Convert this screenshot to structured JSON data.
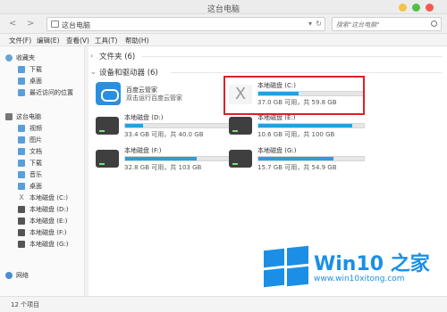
{
  "window": {
    "title": "这台电脑"
  },
  "address": {
    "path": "这台电脑",
    "search_placeholder": "搜索\"这台电脑\""
  },
  "menu": [
    "文件(F)",
    "编辑(E)",
    "查看(V)",
    "工具(T)",
    "帮助(H)"
  ],
  "sidebar": {
    "favorites": {
      "label": "收藏夹",
      "items": [
        "下载",
        "桌面",
        "最近访问的位置"
      ]
    },
    "computer": {
      "label": "这台电脑",
      "items": [
        "视频",
        "图片",
        "文档",
        "下载",
        "音乐",
        "桌面",
        "本地磁盘 (C:)",
        "本地磁盘 (D:)",
        "本地磁盘 (E:)",
        "本地磁盘 (F:)",
        "本地磁盘 (G:)"
      ]
    },
    "network": {
      "label": "网络"
    }
  },
  "groups": {
    "folders": "文件夹 (6)",
    "devices": "设备和驱动器 (6)"
  },
  "cloud": {
    "name": "百度云管家",
    "sub": "双击运行百度云管家"
  },
  "drives": [
    {
      "name": "本地磁盘 (C:)",
      "size": "37.0 GB 可用，共 59.8 GB",
      "used_fraction": 0.38
    },
    {
      "name": "本地磁盘 (D:)",
      "size": "33.4 GB 可用，共 40.0 GB",
      "used_fraction": 0.17
    },
    {
      "name": "本地磁盘 (E:)",
      "size": "10.6 GB 可用，共 100 GB",
      "used_fraction": 0.89
    },
    {
      "name": "本地磁盘 (F:)",
      "size": "32.8 GB 可用，共 103 GB",
      "used_fraction": 0.68
    },
    {
      "name": "本地磁盘 (G:)",
      "size": "15.7 GB 可用，共 54.9 GB",
      "used_fraction": 0.71
    }
  ],
  "status": {
    "text": "12 个项目"
  },
  "watermark": {
    "title": "Win10 之家",
    "url": "www.win10xitong.com"
  },
  "colors": {
    "accent": "#26a0da",
    "highlight": "#e02020",
    "watermark": "#1b8fe6"
  }
}
